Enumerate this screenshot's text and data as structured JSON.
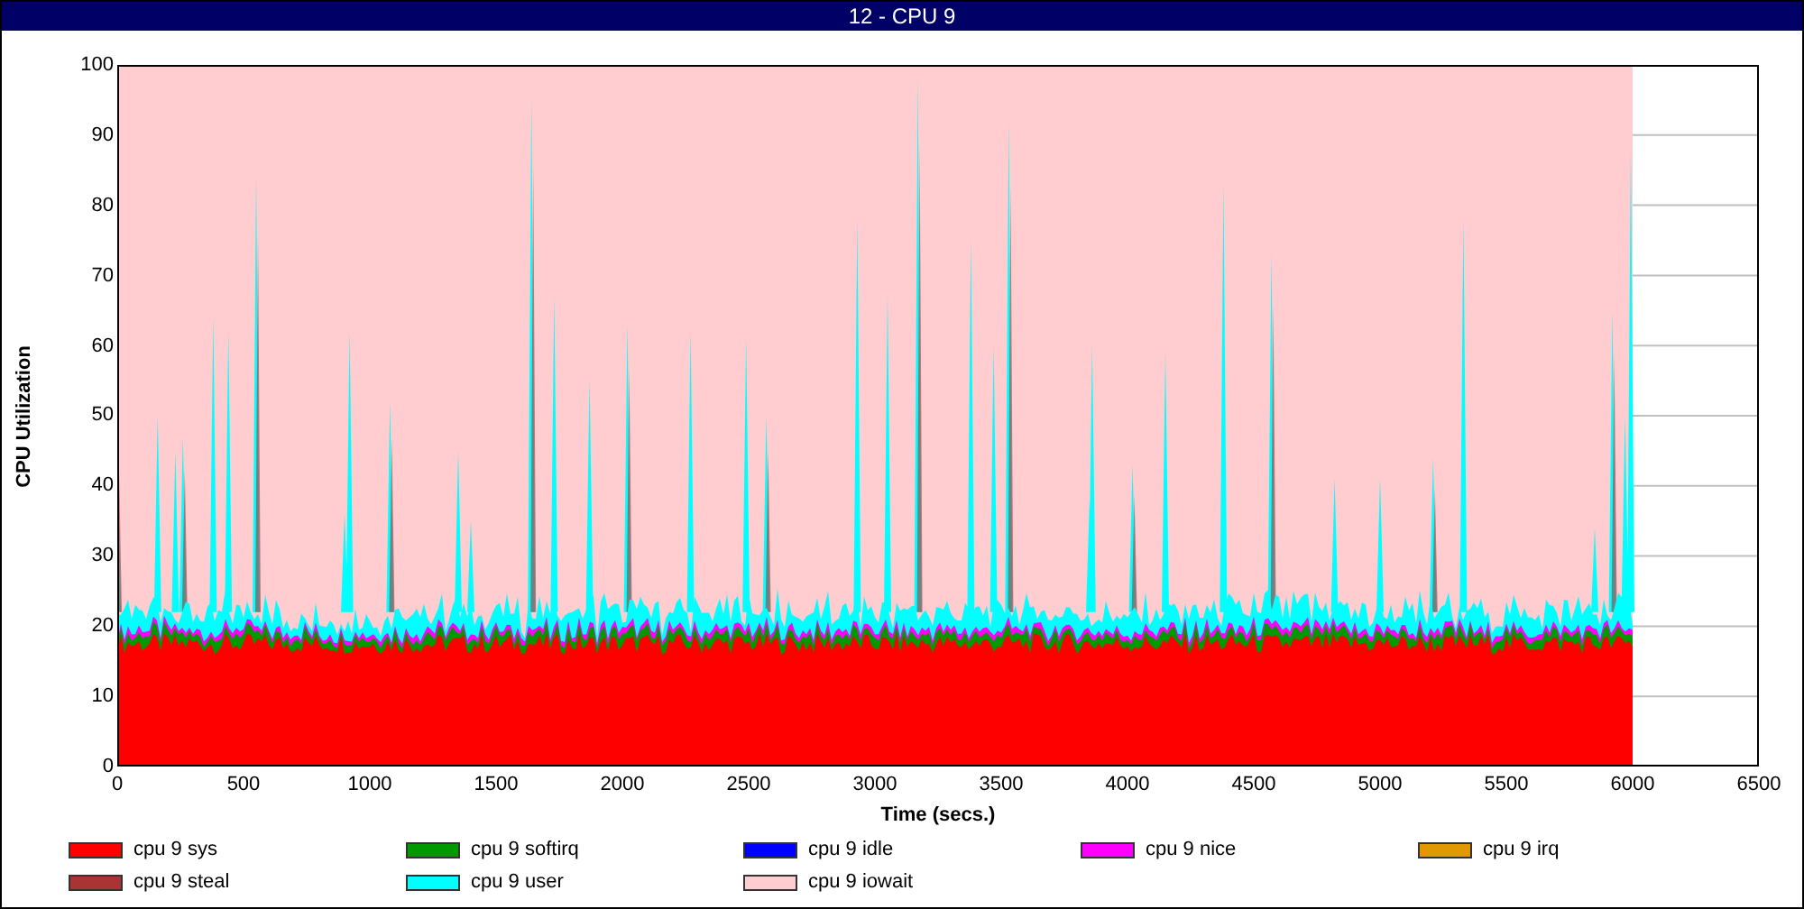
{
  "window": {
    "title": "12 - CPU 9"
  },
  "y_axis": {
    "title": "CPU Utilization",
    "ticks": [
      "100",
      "90",
      "80",
      "70",
      "60",
      "50",
      "40",
      "30",
      "20",
      "10",
      "0"
    ]
  },
  "x_axis": {
    "title": "Time (secs.)",
    "ticks": [
      "0",
      "500",
      "1000",
      "1500",
      "2000",
      "2500",
      "3000",
      "3500",
      "4000",
      "4500",
      "5000",
      "5500",
      "6000",
      "6500"
    ]
  },
  "legend": [
    {
      "label": "cpu 9 sys",
      "color": "#ff0000"
    },
    {
      "label": "cpu 9 softirq",
      "color": "#009900"
    },
    {
      "label": "cpu 9 idle",
      "color": "#0000ff"
    },
    {
      "label": "cpu 9 nice",
      "color": "#ff00ff"
    },
    {
      "label": "cpu 9 irq",
      "color": "#e09900"
    },
    {
      "label": "cpu 9 steal",
      "color": "#aa3333"
    },
    {
      "label": "cpu 9 user",
      "color": "#00ffff"
    },
    {
      "label": "cpu 9 iowait",
      "color": "#ffccd0"
    }
  ]
}
